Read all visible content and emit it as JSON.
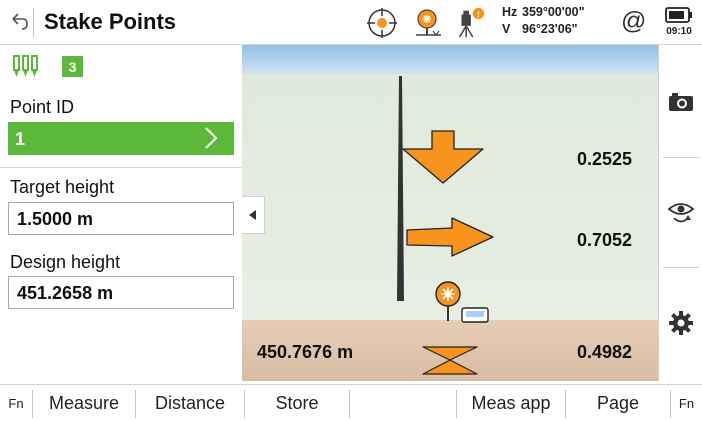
{
  "header": {
    "title": "Stake Points",
    "hz_label": "Hz",
    "hz_value": "359°00'00\"",
    "v_label": "V",
    "v_value": "96°23'06\"",
    "at_symbol": "@",
    "time": "09:10",
    "icons": [
      "back-arrow-icon",
      "crosshair-target-icon",
      "prism-icon",
      "total-station-icon",
      "battery-icon"
    ],
    "warning_badge": "!"
  },
  "left": {
    "tab_icons": [
      "stake-out-icon"
    ],
    "badge": "3",
    "point_id_label": "Point ID",
    "point_id_value": "1",
    "target_height_label": "Target height",
    "target_height_value": "1.5000 m",
    "design_height_label": "Design height",
    "design_height_value": "451.2658 m"
  },
  "graphic": {
    "forward_back_value": "0.2525",
    "right_left_value": "0.7052",
    "height_diff_value": "0.4982",
    "current_height_value": "450.7676 m",
    "arrow_color": "#f7941d"
  },
  "rightbar": {
    "icons": [
      "camera-icon",
      "eye-rotate-icon",
      "gear-icon"
    ]
  },
  "softkeys": {
    "fn_left": "Fn",
    "measure": "Measure",
    "distance": "Distance",
    "store": "Store",
    "empty": "",
    "meas_app": "Meas app",
    "page": "Page",
    "fn_right": "Fn"
  }
}
